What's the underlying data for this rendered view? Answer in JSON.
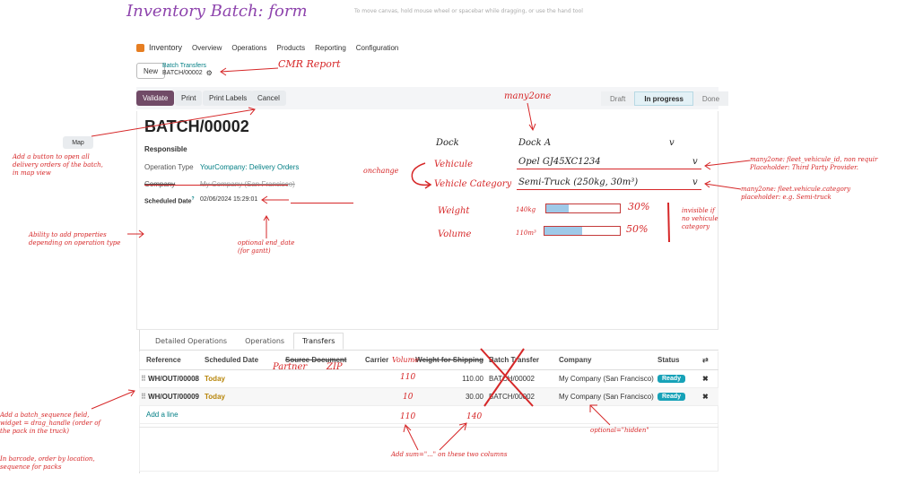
{
  "header": {
    "title": "Inventory Batch: form",
    "hint": "To move canvas, hold mouse wheel or spacebar while dragging, or use the hand tool"
  },
  "nav": {
    "app": "Inventory",
    "items": [
      "Overview",
      "Operations",
      "Products",
      "Reporting",
      "Configuration"
    ]
  },
  "breadcrumb": {
    "new_label": "New",
    "parent": "Batch Transfers",
    "current": "BATCH/00002"
  },
  "toolbar": {
    "validate": "Validate",
    "print": "Print",
    "print_labels": "Print Labels",
    "cancel": "Cancel"
  },
  "pipeline": {
    "stages": [
      "Draft",
      "In progress",
      "Done"
    ],
    "active": "In progress"
  },
  "form": {
    "title": "BATCH/00002",
    "responsible_label": "Responsible",
    "operation_type_label": "Operation Type",
    "operation_type_value": "YourCompany: Delivery Orders",
    "company_label": "Company",
    "company_value": "My Company (San Francisco)",
    "scheduled_label": "Scheduled Date",
    "scheduled_help": "?",
    "scheduled_value": "02/06/2024 15:29:01"
  },
  "mock": {
    "dock_label": "Dock",
    "dock_value": "Dock A",
    "dock_arrow": "v",
    "vehicle_label": "Vehicule",
    "vehicle_value": "Opel GJ45XC1234",
    "vehicle_arrow": "v",
    "category_label": "Vehicle Category",
    "category_value": "Semi-Truck (250kg, 30m³)",
    "category_arrow": "v",
    "weight_label": "Weight",
    "weight_value": "140kg",
    "weight_pct": "30%",
    "weight_fraction": 0.3,
    "volume_label": "Volume",
    "volume_value": "110m³",
    "volume_pct": "50%",
    "volume_fraction": 0.5
  },
  "annotations": {
    "cmr": "CMR Report",
    "many2one_top": "many2one",
    "map_button": "Map",
    "map_note": [
      "Add a button to open all",
      "delivery orders of the batch,",
      "in map view"
    ],
    "onchange": "onchange",
    "vehicle_note": [
      "many2one: fleet_vehicule_id, non requir",
      "Placeholder: Third Party Provider."
    ],
    "category_note": [
      "many2one: fleet.vehicule.category",
      "placeholder: e.g. Semi-truck"
    ],
    "invisible_note": [
      "invisible if",
      "no vehicule",
      "category"
    ],
    "properties_note": [
      "Ability to add properties",
      "depending on operation type"
    ],
    "end_date_note": [
      "optional end_date",
      "(for gantt)"
    ],
    "partner": "Partner",
    "zip": "ZIP",
    "volume_col": "Volume",
    "sequence_note": [
      "Add a batch_sequence field,",
      "widget = drag_handle (order of",
      "the pack in the truck)"
    ],
    "barcode_note": [
      "In barcode, order by location,",
      "sequence for packs"
    ],
    "sum_note": "Add sum=\"...\" on these two columns",
    "hidden_note": "optional=\"hidden\"",
    "sum_volume": "110",
    "sum_weight": "140"
  },
  "tabs": {
    "items": [
      "Detailed Operations",
      "Operations",
      "Transfers"
    ],
    "active": "Transfers"
  },
  "table": {
    "columns": {
      "reference": "Reference",
      "scheduled": "Scheduled Date",
      "source": "Source Document",
      "carrier": "Carrier",
      "weight": "Weight for Shipping",
      "batch": "Batch Transfer",
      "company": "Company",
      "status": "Status"
    },
    "rows": [
      {
        "reference": "WH/OUT/00008",
        "scheduled": "Today",
        "volume": "110",
        "weight": "110.00",
        "batch": "BATCH/00002",
        "company": "My Company (San Francisco)",
        "status": "Ready"
      },
      {
        "reference": "WH/OUT/00009",
        "scheduled": "Today",
        "volume": "10",
        "weight": "30.00",
        "batch": "BATCH/00002",
        "company": "My Company (San Francisco)",
        "status": "Ready"
      }
    ],
    "add_line": "Add a line"
  },
  "colors": {
    "primary": "#714b67",
    "annotation": "#d62728",
    "title": "#8e44ad",
    "link": "#017e84",
    "badge": "#17a2b8"
  }
}
